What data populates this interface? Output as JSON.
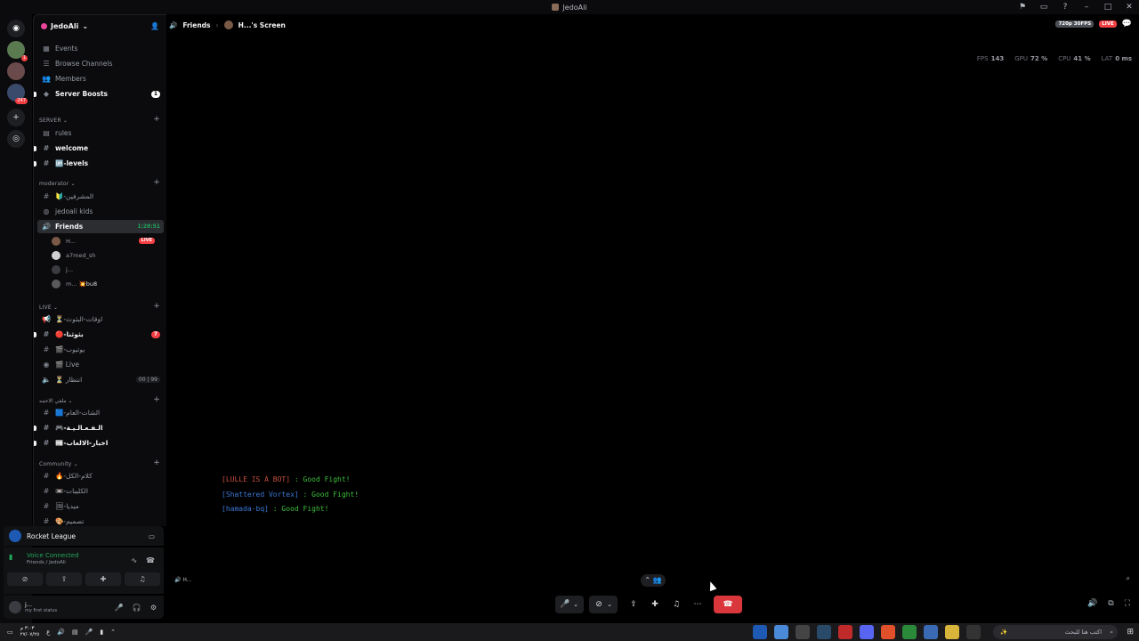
{
  "window": {
    "title": "JedoAli"
  },
  "server": {
    "name": "JedoAli"
  },
  "nav": {
    "events": "Events",
    "browse": "Browse Channels",
    "members": "Members",
    "boosts": "Server Boosts",
    "boosts_count": "1"
  },
  "categories": {
    "server": "SERVER",
    "moderator": "moderator",
    "live": "LIVE",
    "cat4": "ملفي الاحمه",
    "community": "Community"
  },
  "channels": {
    "rules": "rules",
    "welcome": "welcome",
    "levels": "🆙-levels",
    "mods": "🔰-المشرفين",
    "kids": "jedoali kids",
    "friends": "Friends",
    "friends_timer": "1:28:51",
    "times": "⏳-اوقات-البثوث",
    "live1": "🔴-بثوثنا",
    "live1_badge": "7",
    "live2": "🎬-يوتيوب",
    "live3": "🎬 Live",
    "wait": "⏳ انتظار",
    "wait_count": "00 | 99",
    "c1": "🟦-الشات-العام",
    "c2": "🎮-الـفـعـالـيـة",
    "c3": "📰-اخبار-الالعاب",
    "c4": "🔥-كلام-الكل",
    "c5": "📼-الكليبات",
    "c6": "🖼-ميديا",
    "c7": "🎨-تصميم"
  },
  "voice_users": [
    {
      "name": "H...",
      "live": "LIVE"
    },
    {
      "name": "a7med_sh"
    },
    {
      "name": "j..."
    },
    {
      "name": "m...",
      "status": "💥bu8"
    }
  ],
  "activity": {
    "game": "Rocket League"
  },
  "voice": {
    "status": "Voice Connected",
    "location": "Friends / JedoAli"
  },
  "user": {
    "name": "j...",
    "status": "my first status"
  },
  "header": {
    "channel": "Friends",
    "screen": "H...'s Screen",
    "quality": "720p 30FPS",
    "live": "LIVE"
  },
  "perf": {
    "fps_label": "FPS",
    "fps": "143",
    "gpu_label": "GPU",
    "gpu": "72 %",
    "cpu_label": "CPU",
    "cpu": "41 %",
    "lat_label": "LAT",
    "lat": "0 ms"
  },
  "chat": [
    {
      "name": "[LULLE IS A BOT]",
      "msg": " : Good Fight!"
    },
    {
      "name": "[Shattered Vortex]",
      "msg": " : Good Fight!"
    },
    {
      "name": "[hamada-bq]",
      "msg": " : Good Fight!"
    }
  ],
  "stream_label": "H...",
  "taskbar": {
    "time": "٣:٠٣ م",
    "date": "٢٧/٠٧/٢٥",
    "search_placeholder": "اكتب هنا للبحث"
  },
  "badges": {
    "s1": "1",
    "s2": "247"
  },
  "colors": {
    "accent": "#5865f2",
    "live": "#f23f43",
    "connected": "#23a55a",
    "endcall": "#da373c"
  }
}
